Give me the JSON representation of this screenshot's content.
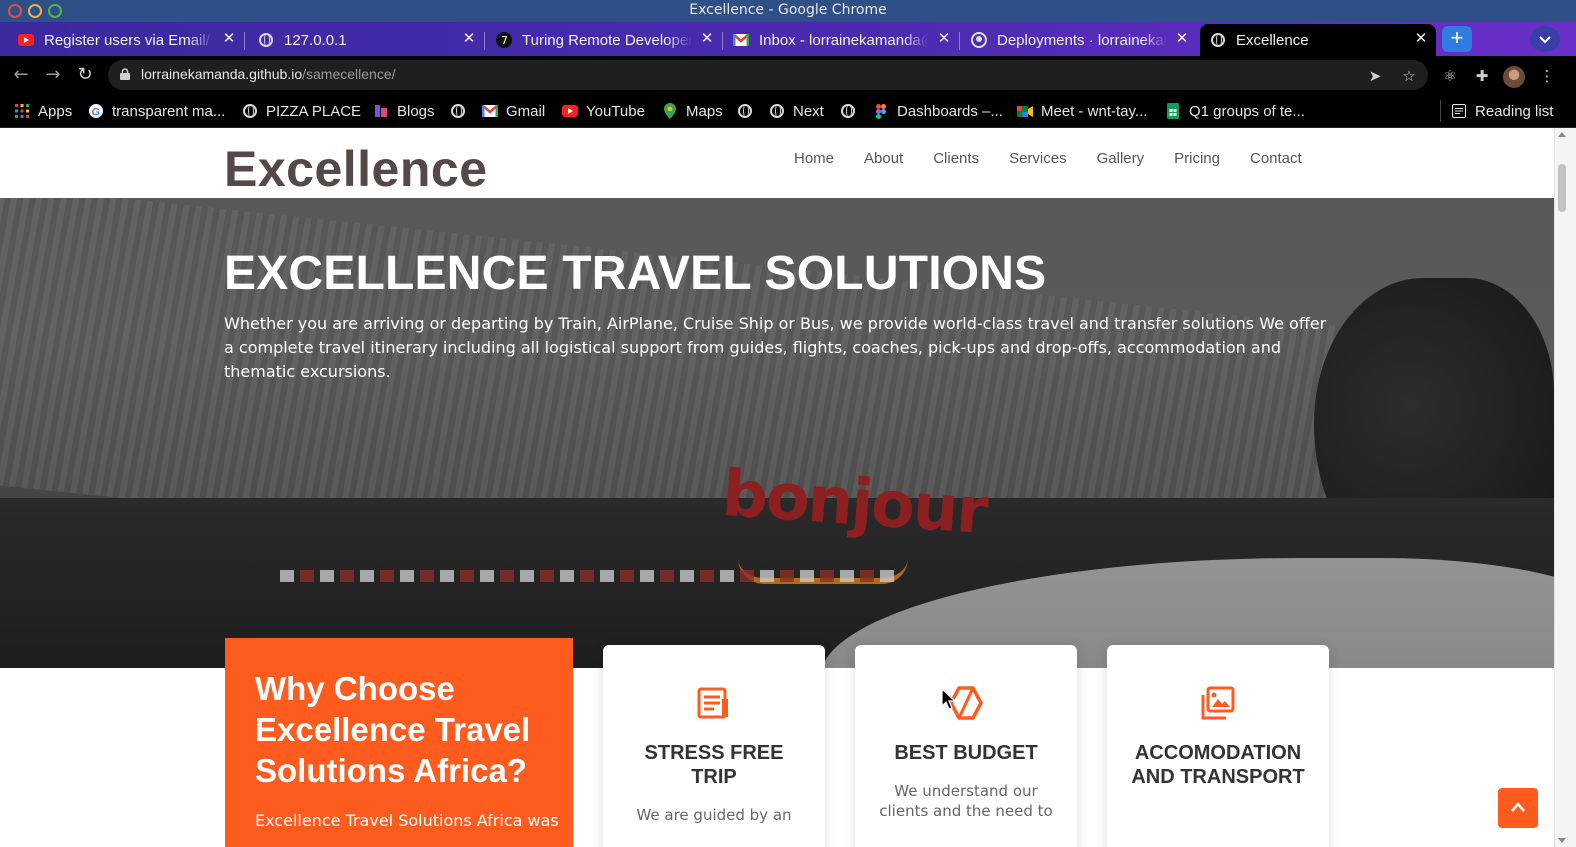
{
  "window": {
    "title": "Excellence - Google Chrome"
  },
  "tabs": [
    {
      "label": "Register users via Email/ S",
      "icon": "youtube-icon"
    },
    {
      "label": "127.0.0.1",
      "icon": "globe-icon"
    },
    {
      "label": "Turing Remote Developer",
      "icon": "turing-icon"
    },
    {
      "label": "Inbox - lorrainekamanda@",
      "icon": "gmail-icon"
    },
    {
      "label": "Deployments · lorrainekan",
      "icon": "github-icon"
    },
    {
      "label": "Excellence",
      "icon": "globe-icon",
      "active": true
    }
  ],
  "address": {
    "domain": "lorrainekamanda.github.io",
    "path": "/samecellence/"
  },
  "bookmarks": [
    {
      "label": "Apps",
      "icon": "apps-grid-icon"
    },
    {
      "label": "transparent ma...",
      "icon": "google-icon"
    },
    {
      "label": "PIZZA PLACE",
      "icon": "globe-icon"
    },
    {
      "label": "Blogs",
      "icon": "blogs-icon"
    },
    {
      "label": "",
      "icon": "globe-icon"
    },
    {
      "label": "Gmail",
      "icon": "gmail-icon"
    },
    {
      "label": "YouTube",
      "icon": "youtube-icon"
    },
    {
      "label": "Maps",
      "icon": "maps-icon"
    },
    {
      "label": "",
      "icon": "globe-icon"
    },
    {
      "label": "Next",
      "icon": "globe-icon"
    },
    {
      "label": "",
      "icon": "globe-icon"
    },
    {
      "label": "Dashboards –...",
      "icon": "figma-icon"
    },
    {
      "label": "Meet - wnt-tay...",
      "icon": "meet-icon"
    },
    {
      "label": "Q1 groups of te...",
      "icon": "sheets-icon"
    }
  ],
  "reading_list": "Reading list",
  "site": {
    "logo": "Excellence",
    "nav": [
      "Home",
      "About",
      "Clients",
      "Services",
      "Gallery",
      "Pricing",
      "Contact"
    ],
    "hero": {
      "title": "EXCELLENCE TRAVEL SOLUTIONS",
      "text": "Whether you are arriving or departing by Train, AirPlane, Cruise Ship or Bus, we provide world-class travel and transfer solutions We offer a complete travel itinerary including all logistical support from guides, flights, coaches, pick-ups and drop-offs, accommodation and thematic excursions.",
      "sign_text": "bonjour"
    },
    "why": {
      "title": "Why Choose Excellence Travel Solutions Africa?",
      "text": "Excellence Travel Solutions Africa was"
    },
    "features": [
      {
        "title": "STRESS FREE TRIP",
        "text": "We are guided by an",
        "icon": "document-icon"
      },
      {
        "title": "BEST BUDGET",
        "text": "We understand our clients and the need to",
        "icon": "hexagon-icon"
      },
      {
        "title": "ACCOMODATION AND TRANSPORT",
        "text": "",
        "icon": "images-icon"
      }
    ]
  },
  "colors": {
    "accent": "#fe5b1f",
    "logo": "#554848",
    "tabstrip": "#4a2bb0",
    "titlebar": "#2f4f87"
  }
}
